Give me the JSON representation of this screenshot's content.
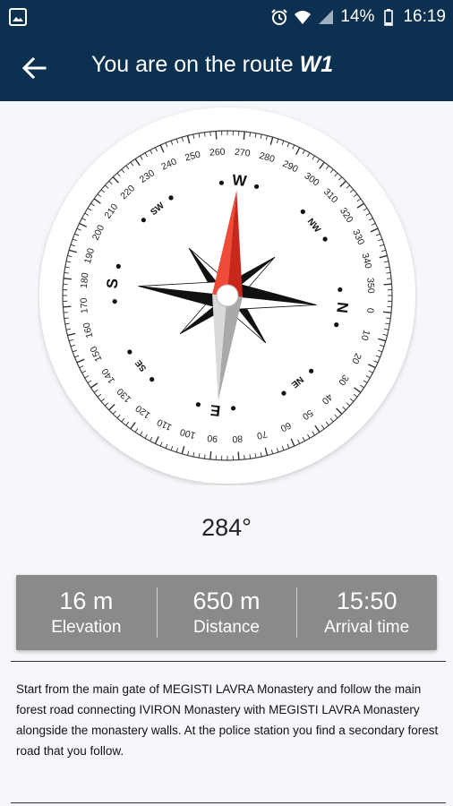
{
  "status_bar": {
    "battery_percent": "14%",
    "time": "16:19",
    "icons": [
      "image-icon",
      "alarm-icon",
      "wifi-icon",
      "signal-icon",
      "battery-icon"
    ]
  },
  "app_bar": {
    "title_prefix": "You are on the route",
    "route": "W1"
  },
  "compass": {
    "degree_labels": [
      "0",
      "10",
      "20",
      "30",
      "40",
      "50",
      "60",
      "70",
      "80",
      "90",
      "100",
      "110",
      "120",
      "130",
      "140",
      "150",
      "160",
      "170",
      "180",
      "190",
      "200",
      "210",
      "220",
      "230",
      "240",
      "250",
      "260",
      "270",
      "280",
      "290",
      "300",
      "310",
      "320",
      "330",
      "340",
      "350"
    ],
    "cardinals": [
      "N",
      "E",
      "S",
      "W"
    ],
    "intercardinals": [
      "NE",
      "SE",
      "SW",
      "NW"
    ]
  },
  "heading": "284°",
  "stats": [
    {
      "value": "16 m",
      "label": "Elevation"
    },
    {
      "value": "650 m",
      "label": "Distance"
    },
    {
      "value": "15:50",
      "label": "Arrival time"
    }
  ],
  "description": "Start from the main gate of MEGISTI LAVRA Monastery and follow the main forest road connecting IVIRON Monastery with MEGISTI LAVRA Monastery alongside the monastery walls. At the police station you find a secondary forest road that you follow.",
  "colors": {
    "app_bar": "#0c3150",
    "stats_panel": "#8a8a8a",
    "needle_north": "#e8372a"
  }
}
